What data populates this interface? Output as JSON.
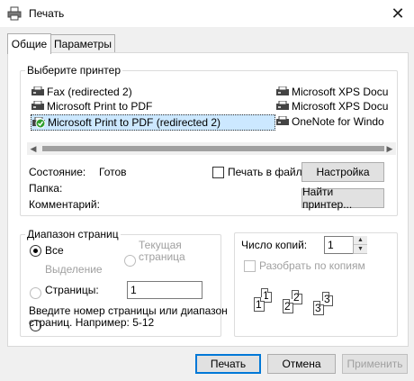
{
  "window": {
    "title": "Печать"
  },
  "tabs": [
    {
      "label": "Общие"
    },
    {
      "label": "Параметры"
    }
  ],
  "printer_group": {
    "legend": "Выберите принтер",
    "printers": [
      {
        "name": "Fax (redirected 2)"
      },
      {
        "name": "Microsoft Print to PDF"
      },
      {
        "name": "Microsoft Print to PDF (redirected 2)",
        "selected": true
      },
      {
        "name": "Microsoft XPS Docu"
      },
      {
        "name": "Microsoft XPS Docu"
      },
      {
        "name": "OneNote for Windo"
      }
    ],
    "status_label": "Состояние:",
    "status_value": "Готов",
    "folder_label": "Папка:",
    "comment_label": "Комментарий:",
    "print_to_file_label": "Печать в файл",
    "settings_button": "Настройка",
    "find_printer_button": "Найти принтер..."
  },
  "page_range": {
    "legend": "Диапазон страниц",
    "all_label": "Все",
    "selection_label": "Выделение",
    "current_page_label_1": "Текущая",
    "current_page_label_2": "страница",
    "pages_label": "Страницы:",
    "pages_value": "1",
    "hint_line_1": "Введите номер страницы или диапазон",
    "hint_line_2": "страниц.  Например: 5-12"
  },
  "copies": {
    "label": "Число копий:",
    "value": "1",
    "collate_label": "Разобрать по копиям",
    "page_numbers": [
      "1",
      "1",
      "2",
      "2",
      "3",
      "3"
    ]
  },
  "footer": {
    "print_button": "Печать",
    "cancel_button": "Отмена",
    "apply_button": "Применить"
  },
  "colors": {
    "accent": "#0078d7",
    "selection": "#cce8ff",
    "success": "#2e9e2e"
  }
}
